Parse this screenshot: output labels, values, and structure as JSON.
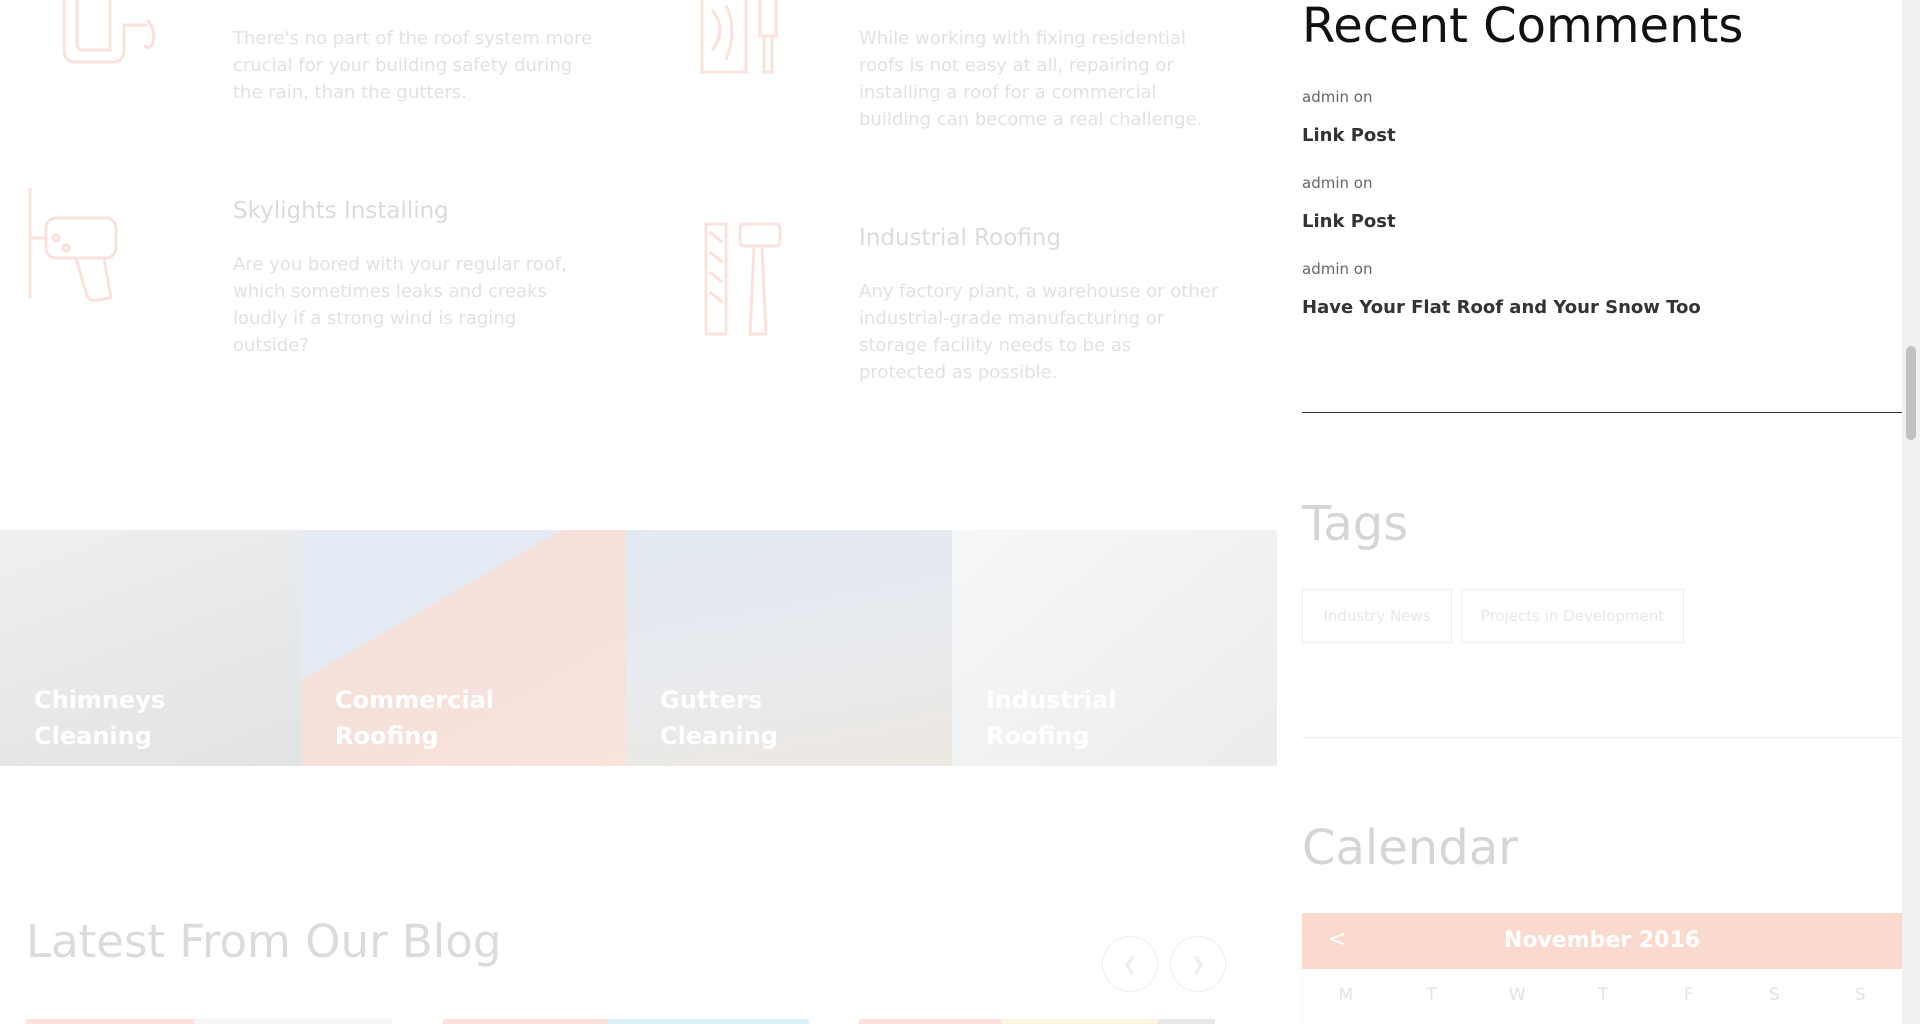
{
  "services": [
    {
      "title": "",
      "text": "There's no part of the roof system more crucial for your building safety during the rain, than the gutters.",
      "icon": "drain-pipe-icon"
    },
    {
      "title": "",
      "text": "While working with fixing residential roofs is not easy at all, repairing or installing a roof for a commercial building can become a real challenge.",
      "icon": "tools-icon"
    },
    {
      "title": "Skylights Installing",
      "text": "Are you bored with your regular roof, which sometimes leaks and creaks loudly if a strong wind is raging outside?",
      "icon": "drill-icon"
    },
    {
      "title": "Industrial Roofing",
      "text": "Any factory plant, a warehouse or other industrial-grade manufacturing or storage facility needs to be as protected as possible.",
      "icon": "hammer-file-icon"
    }
  ],
  "tiles": [
    {
      "line1": "Chimneys",
      "line2": "Cleaning"
    },
    {
      "line1": "Commercial",
      "line2": "Roofing"
    },
    {
      "line1": "Gutters",
      "line2": "Cleaning"
    },
    {
      "line1": "Industrial",
      "line2": "Roofing"
    }
  ],
  "blog": {
    "title": "Latest From Our Blog",
    "prev_icon": "chevron-left-icon",
    "next_icon": "chevron-right-icon"
  },
  "sidebar": {
    "recent_comments": {
      "heading": "Recent Comments",
      "items": [
        {
          "meta": "admin on",
          "link": "Link Post"
        },
        {
          "meta": "admin on",
          "link": "Link Post"
        },
        {
          "meta": "admin on",
          "link": "Have Your Flat Roof and Your Snow Too"
        }
      ]
    },
    "tags": {
      "heading": "Tags",
      "items": [
        "Industry News",
        "Projects in Development"
      ]
    },
    "calendar": {
      "heading": "Calendar",
      "month": "November 2016",
      "prev": "<",
      "days": [
        "M",
        "T",
        "W",
        "T",
        "F",
        "S",
        "S"
      ]
    }
  },
  "colors": {
    "accent": "#f4a58c",
    "calendar_header": "#fad9cf"
  }
}
